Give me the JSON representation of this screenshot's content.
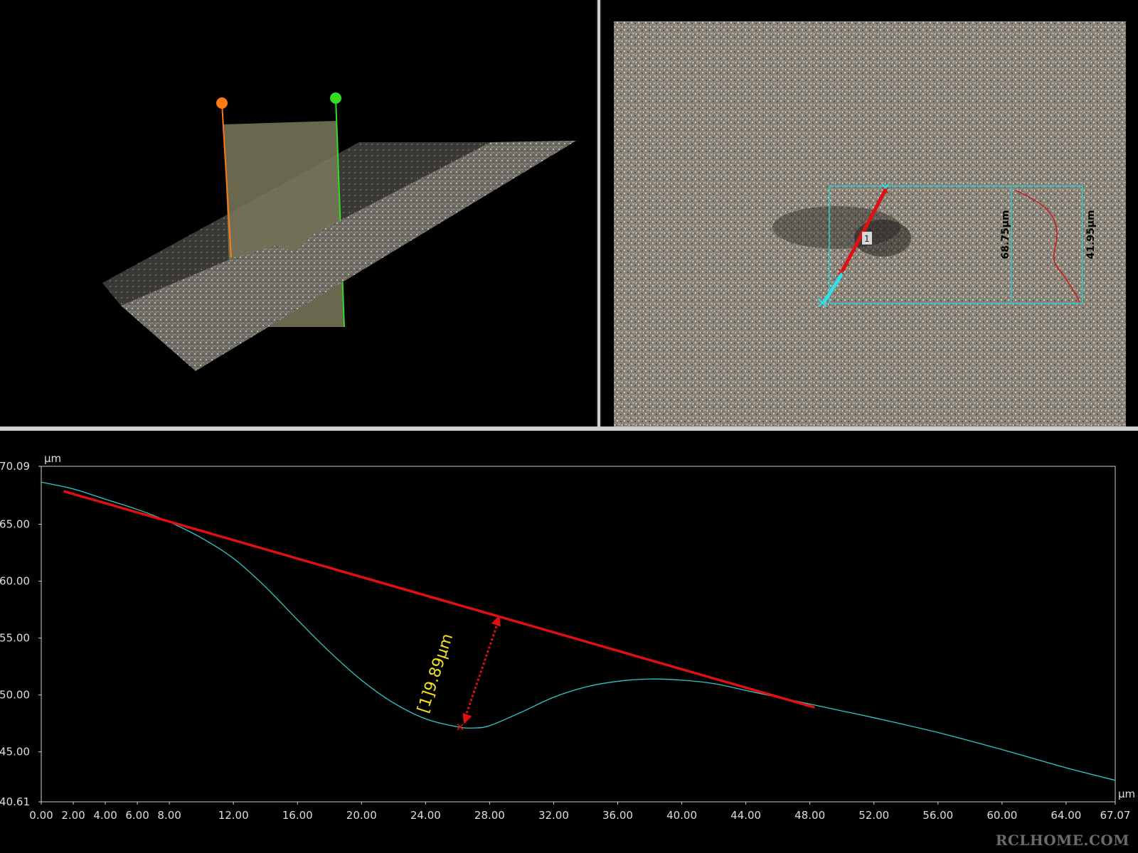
{
  "colors": {
    "profile": "#2fc9c9",
    "reference": "#e01010",
    "measurement": "#f0e020",
    "handle_start": "#ff7a10",
    "handle_end": "#33dd22"
  },
  "view3d": {
    "start_handle": "orange-dot-icon",
    "end_handle": "green-dot-icon"
  },
  "image_view": {
    "marker_label": "1",
    "box_height_label": "68.75µm",
    "box_depth_label": "41.95µm"
  },
  "profile": {
    "measurement_label": "[1]9.89µm",
    "watermark": "RCLHOME.COM"
  },
  "chart_data": {
    "type": "line",
    "xlabel": "µm",
    "ylabel": "µm",
    "xlim": [
      0.0,
      67.07
    ],
    "ylim": [
      40.61,
      70.09
    ],
    "xticks": [
      "0.00",
      "2.00",
      "4.00",
      "6.00",
      "8.00",
      "12.00",
      "16.00",
      "20.00",
      "24.00",
      "28.00",
      "32.00",
      "36.00",
      "40.00",
      "44.00",
      "48.00",
      "52.00",
      "56.00",
      "60.00",
      "64.00",
      "67.07"
    ],
    "yticks": [
      "70.09",
      "65.00",
      "60.00",
      "55.00",
      "50.00",
      "45.00",
      "40.61"
    ],
    "series": [
      {
        "x": [
          0,
          2,
          4,
          6,
          8,
          10,
          12,
          14,
          16,
          18,
          20,
          22,
          24,
          26,
          27,
          28,
          30,
          32,
          34,
          36,
          38,
          40,
          42,
          44,
          46,
          48,
          50,
          52,
          56,
          60,
          64,
          67.07
        ],
        "y": [
          68.7,
          68.1,
          67.2,
          66.3,
          65.2,
          63.8,
          62.0,
          59.5,
          56.6,
          53.8,
          51.3,
          49.3,
          47.9,
          47.2,
          47.1,
          47.3,
          48.5,
          49.8,
          50.7,
          51.2,
          51.4,
          51.3,
          51.0,
          50.4,
          49.8,
          49.2,
          48.6,
          48.0,
          46.7,
          45.2,
          43.6,
          42.5
        ]
      }
    ],
    "reference_line": {
      "x": [
        1.4,
        48.3
      ],
      "y": [
        67.9,
        48.9
      ]
    },
    "measurement": {
      "x": 27.5,
      "y_from": 47.2,
      "y_to": 57.1,
      "value_label": "[1]9.89µm"
    }
  }
}
